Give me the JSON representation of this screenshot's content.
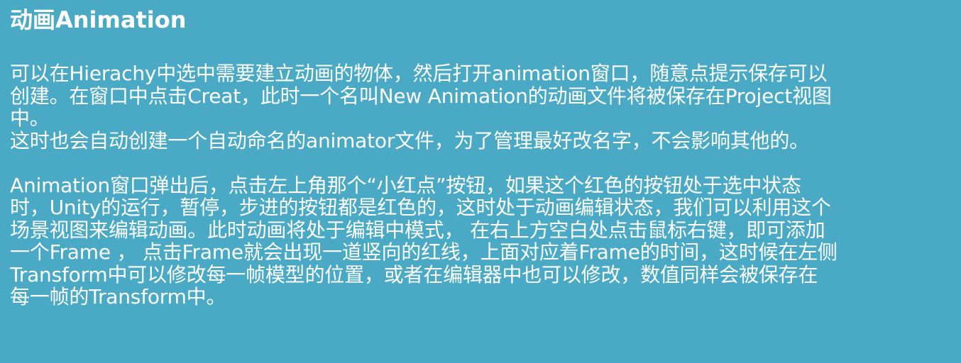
{
  "slide": {
    "title": "动画Animation",
    "paragraph1": [
      "可以在Hierachy中选中需要建立动画的物体，然后打开animation窗口，随意点提示保存可以",
      "创建。在窗口中点击Creat，此时一个名叫New Animation的动画文件将被保存在Project视图",
      "中。",
      "这时也会自动创建一个自动命名的animator文件，为了管理最好改名字，不会影响其他的。"
    ],
    "paragraph2": [
      "Animation窗口弹出后，点击左上角那个“小红点”按钮，如果这个红色的按钮处于选中状态",
      "时，Unity的运行，暂停，步进的按钮都是红色的，这时处于动画编辑状态，我们可以利用这个",
      "场景视图来编辑动画。此时动画将处于编辑中模式， 在右上方空白处点击鼠标右键，即可添加",
      "一个Frame ， 点击Frame就会出现一道竖向的红线，上面对应着Frame的时间，这时候在左侧",
      "Transform中可以修改每一帧模型的位置，或者在编辑器中也可以修改，数值同样会被保存在",
      "每一帧的Transform中。"
    ]
  },
  "colors": {
    "background": "#4aaac6",
    "text": "#ffffff"
  }
}
